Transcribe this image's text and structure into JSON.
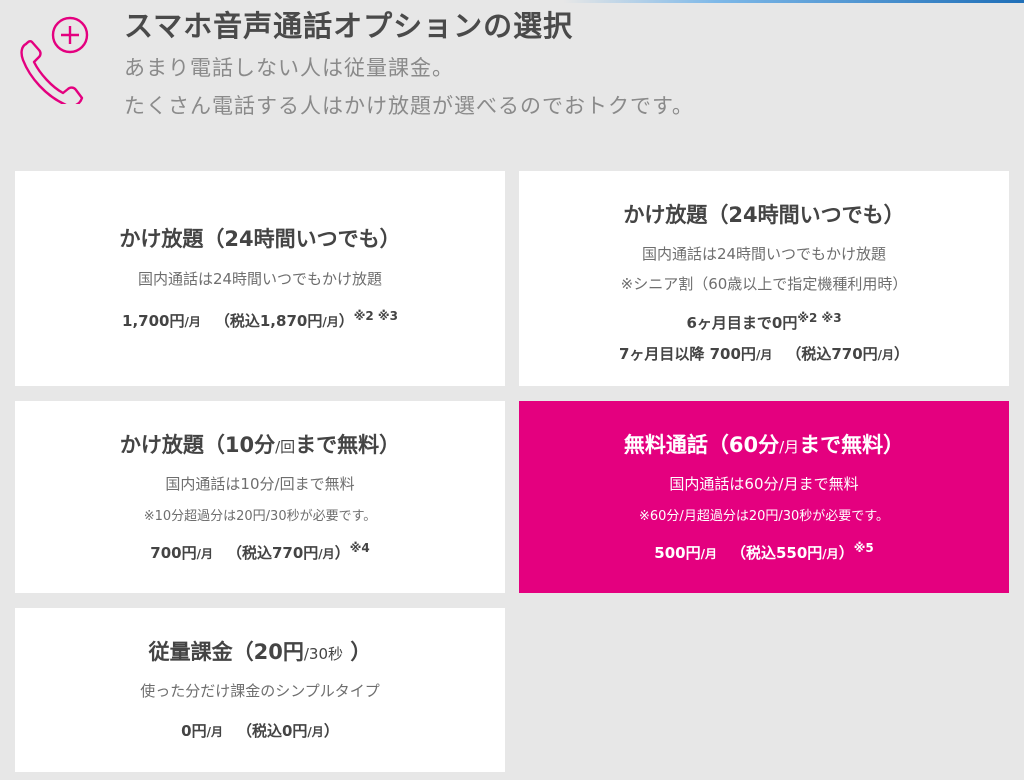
{
  "header": {
    "title": "スマホ音声通話オプションの選択",
    "subtitle_line1": "あまり電話しない人は従量課金。",
    "subtitle_line2": "たくさん電話する人はかけ放題が選べるのでおトクです。",
    "icon": "phone-plus-icon"
  },
  "colors": {
    "accent": "#e4007f",
    "background": "#e7e7e7",
    "card": "#ffffff"
  },
  "plans": [
    {
      "title_main": "かけ放題（24時間いつでも）",
      "desc": "国内通話は24時間いつでもかけ放題",
      "price_value": "1,700円",
      "unit": "/月",
      "tax_open": "（税込1,870円",
      "tax_close": "）",
      "note_marks": "※2 ※3"
    },
    {
      "title_main": "かけ放題（24時間いつでも）",
      "desc": "国内通話は24時間いつでもかけ放題",
      "desc2": "※シニア割（60歳以上で指定機種利用時）",
      "line1_value": "6ヶ月目まで0円",
      "line1_marks": "※2 ※3",
      "line2_value": "7ヶ月目以降 700円",
      "unit": "/月",
      "tax_open": "（税込770円",
      "tax_close": "）"
    },
    {
      "title_a": "かけ放題（10分",
      "title_small": "/回",
      "title_b": "まで無料）",
      "desc": "国内通話は10分/回まで無料",
      "note": "※10分超過分は20円/30秒が必要です。",
      "price_value": "700円",
      "unit": "/月",
      "tax_open": "（税込770円",
      "tax_close": "）",
      "note_marks": "※4"
    },
    {
      "title_a": "無料通話（60分",
      "title_small": "/月",
      "title_b": "まで無料）",
      "desc": "国内通話は60分/月まで無料",
      "note": "※60分/月超過分は20円/30秒が必要です。",
      "price_value": "500円",
      "unit": "/月",
      "tax_open": "（税込550円",
      "tax_close": "）",
      "note_marks": "※5"
    },
    {
      "title_a": "従量課金（20円",
      "title_small": "/30秒",
      "title_b": " ）",
      "desc": "使った分だけ課金のシンプルタイプ",
      "price_value": "0円",
      "unit": "/月",
      "tax_open": "（税込0円",
      "tax_close": "）"
    }
  ]
}
